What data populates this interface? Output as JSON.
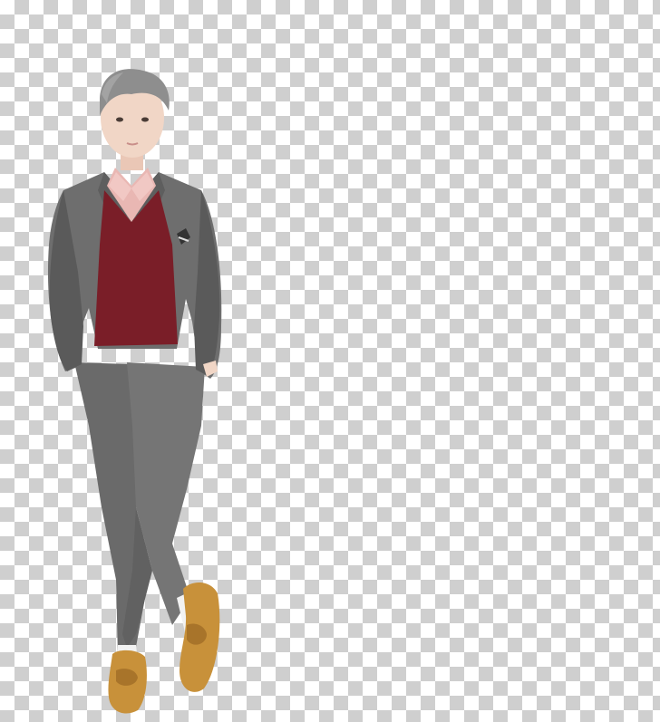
{
  "image": {
    "subject": "standing-person",
    "background": "transparency-checkerboard",
    "colors": {
      "suit": "#6e6e6e",
      "suit_dark": "#4f4f4f",
      "sweater": "#7a1e28",
      "shirt": "#e9b7b3",
      "shoes": "#c8913a",
      "hair": "#8e8e8e",
      "skin": "#f1d6c6",
      "socks": "#f4f4f4"
    }
  }
}
